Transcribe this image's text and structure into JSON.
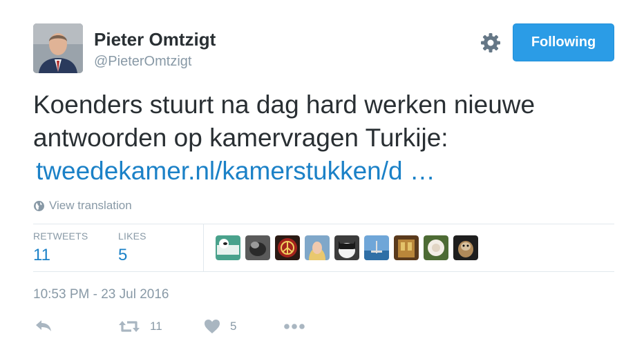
{
  "user": {
    "name": "Pieter Omtzigt",
    "handle": "@PieterOmtzigt"
  },
  "follow_button": {
    "label": "Following"
  },
  "tweet": {
    "text": "Koenders stuurt na dag hard werken nieuwe antwoorden op kamervragen Turkije:",
    "link": "tweedekamer.nl/kamerstukken/d …"
  },
  "translate": {
    "label": "View translation"
  },
  "stats": {
    "retweets_label": "RETWEETS",
    "retweets_count": "11",
    "likes_label": "LIKES",
    "likes_count": "5"
  },
  "timestamp": "10:53 PM - 23 Jul 2016",
  "actions": {
    "retweet_count": "11",
    "like_count": "5"
  },
  "colors": {
    "accent": "#2b9ce6",
    "link": "#1b81c7",
    "muted": "#8899a6"
  },
  "icons": [
    "gear-icon",
    "globe-icon",
    "reply-icon",
    "retweet-icon",
    "heart-icon",
    "more-icon"
  ]
}
